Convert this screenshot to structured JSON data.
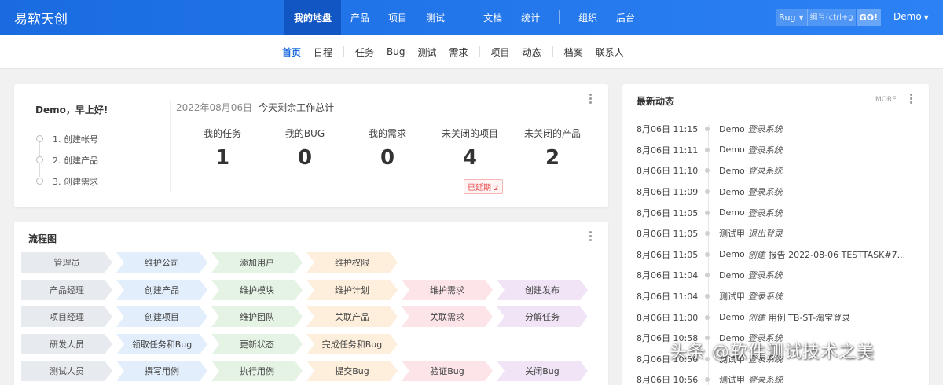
{
  "brand": "易软天创",
  "mainnav": [
    {
      "label": "我的地盘",
      "active": true
    },
    {
      "label": "产品"
    },
    {
      "label": "项目"
    },
    {
      "label": "测试"
    },
    {
      "label": "文档"
    },
    {
      "label": "统计"
    },
    {
      "label": "组织"
    },
    {
      "label": "后台"
    }
  ],
  "search": {
    "type": "Bug",
    "placeholder": "编号(ctrl+g)",
    "go": "GO!"
  },
  "user": "Demo",
  "subnav": [
    {
      "label": "首页",
      "active": true
    },
    {
      "label": "日程"
    },
    {
      "label": "任务"
    },
    {
      "label": "Bug"
    },
    {
      "label": "测试"
    },
    {
      "label": "需求"
    },
    {
      "label": "项目"
    },
    {
      "label": "动态"
    },
    {
      "label": "档案"
    },
    {
      "label": "联系人"
    }
  ],
  "welcome": {
    "greeting": "Demo，早上好!",
    "steps": [
      "1. 创建帐号",
      "2. 创建产品",
      "3. 创建需求"
    ],
    "date": "2022年08月06日",
    "summary": "今天剩余工作总计",
    "stats": [
      {
        "label": "我的任务",
        "value": "1"
      },
      {
        "label": "我的BUG",
        "value": "0"
      },
      {
        "label": "我的需求",
        "value": "0"
      },
      {
        "label": "未关闭的项目",
        "value": "4"
      },
      {
        "label": "未关闭的产品",
        "value": "2"
      }
    ],
    "delayed": "已延期 2"
  },
  "flow": {
    "title": "流程图",
    "rows": [
      {
        "role": "管理员",
        "steps": [
          "维护公司",
          "添加用户",
          "维护权限"
        ]
      },
      {
        "role": "产品经理",
        "steps": [
          "创建产品",
          "维护模块",
          "维护计划",
          "维护需求",
          "创建发布"
        ]
      },
      {
        "role": "项目经理",
        "steps": [
          "创建项目",
          "维护团队",
          "关联产品",
          "关联需求",
          "分解任务"
        ]
      },
      {
        "role": "研发人员",
        "steps": [
          "领取任务和Bug",
          "更新状态",
          "完成任务和Bug"
        ]
      },
      {
        "role": "测试人员",
        "steps": [
          "撰写用例",
          "执行用例",
          "提交Bug",
          "验证Bug",
          "关闭Bug"
        ]
      }
    ]
  },
  "dynamics": {
    "title": "最新动态",
    "more": "MORE",
    "events": [
      {
        "time": "8月06日 11:15",
        "who": "Demo",
        "action": "登录系统",
        "object": ""
      },
      {
        "time": "8月06日 11:11",
        "who": "Demo",
        "action": "登录系统",
        "object": ""
      },
      {
        "time": "8月06日 11:10",
        "who": "Demo",
        "action": "登录系统",
        "object": ""
      },
      {
        "time": "8月06日 11:09",
        "who": "Demo",
        "action": "登录系统",
        "object": ""
      },
      {
        "time": "8月06日 11:05",
        "who": "Demo",
        "action": "登录系统",
        "object": ""
      },
      {
        "time": "8月06日 11:05",
        "who": "测试甲",
        "action": "退出登录",
        "object": ""
      },
      {
        "time": "8月06日 11:05",
        "who": "Demo",
        "action": "创建",
        "object": "报告 2022-08-06 TESTTASK#7..."
      },
      {
        "time": "8月06日 11:04",
        "who": "Demo",
        "action": "登录系统",
        "object": ""
      },
      {
        "time": "8月06日 11:04",
        "who": "测试甲",
        "action": "登录系统",
        "object": ""
      },
      {
        "time": "8月06日 11:00",
        "who": "Demo",
        "action": "创建",
        "object": "用例 TB-ST-淘宝登录"
      },
      {
        "time": "8月06日 10:58",
        "who": "Demo",
        "action": "登录系统",
        "object": ""
      },
      {
        "time": "8月06日 10:56",
        "who": "测试甲",
        "action": "登录系统",
        "object": ""
      },
      {
        "time": "8月06日 10:56",
        "who": "测试甲",
        "action": "登录系统",
        "object": ""
      }
    ]
  },
  "watermark": "头条 @软件测试技术之美",
  "colors": {
    "topbar": "#1a6be0",
    "active_nav": "#1256c4",
    "accent": "#1a6be0",
    "badge": "#e84a4a"
  }
}
